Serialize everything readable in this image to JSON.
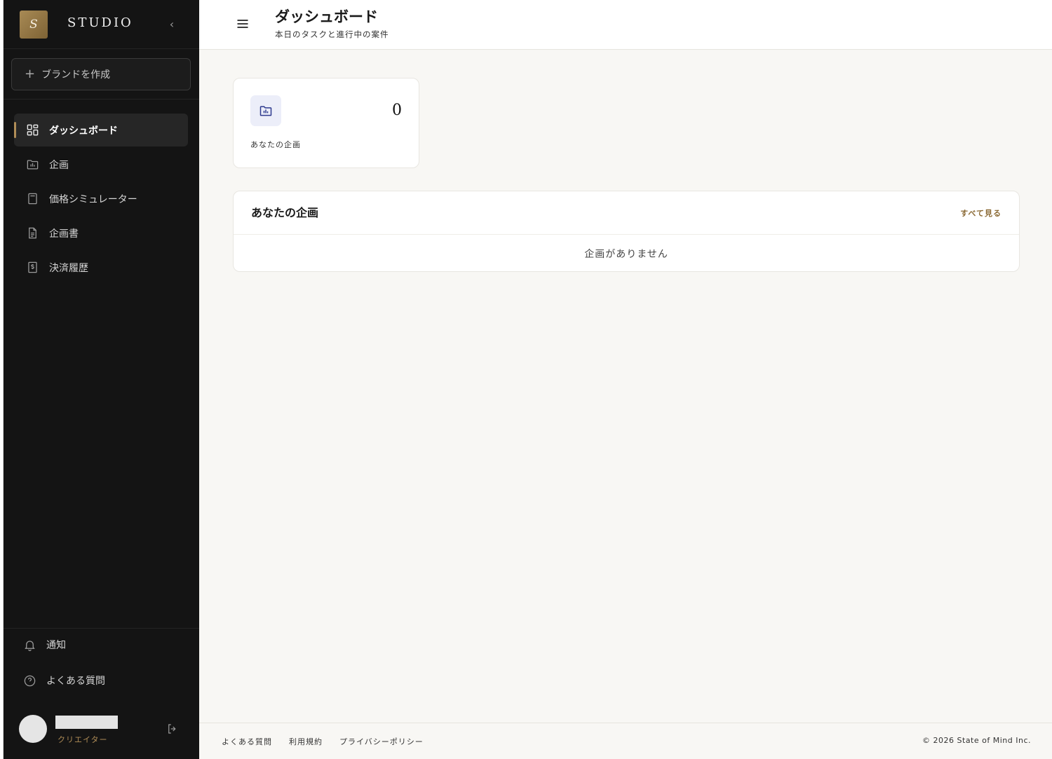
{
  "sidebar": {
    "logo_letter": "S",
    "brand_name": "STUDIO",
    "collapse_icon": "chevron-left-icon",
    "create_brand_label": "ブランドを作成",
    "nav": [
      {
        "label": "ダッシュボード",
        "icon": "grid-icon",
        "active": true
      },
      {
        "label": "企画",
        "icon": "folder-chart-icon",
        "active": false
      },
      {
        "label": "価格シミュレーター",
        "icon": "calculator-icon",
        "active": false
      },
      {
        "label": "企画書",
        "icon": "document-icon",
        "active": false
      },
      {
        "label": "決済履歴",
        "icon": "dollar-receipt-icon",
        "active": false
      }
    ],
    "bottom": [
      {
        "label": "通知",
        "icon": "bell-icon"
      },
      {
        "label": "よくある質問",
        "icon": "help-circle-icon"
      }
    ],
    "user": {
      "role": "クリエイター"
    },
    "accent_color": "#b08d57"
  },
  "header": {
    "title": "ダッシュボード",
    "subtitle": "本日のタスクと進行中の案件"
  },
  "stats": {
    "plans_count": "0",
    "plans_label": "あなたの企画"
  },
  "plans_panel": {
    "title": "あなたの企画",
    "view_all": "すべて見る",
    "empty_message": "企画がありません"
  },
  "footer": {
    "links": [
      "よくある質問",
      "利用規約",
      "プライバシーポリシー"
    ],
    "copyright": "© 2026 State of Mind Inc."
  }
}
